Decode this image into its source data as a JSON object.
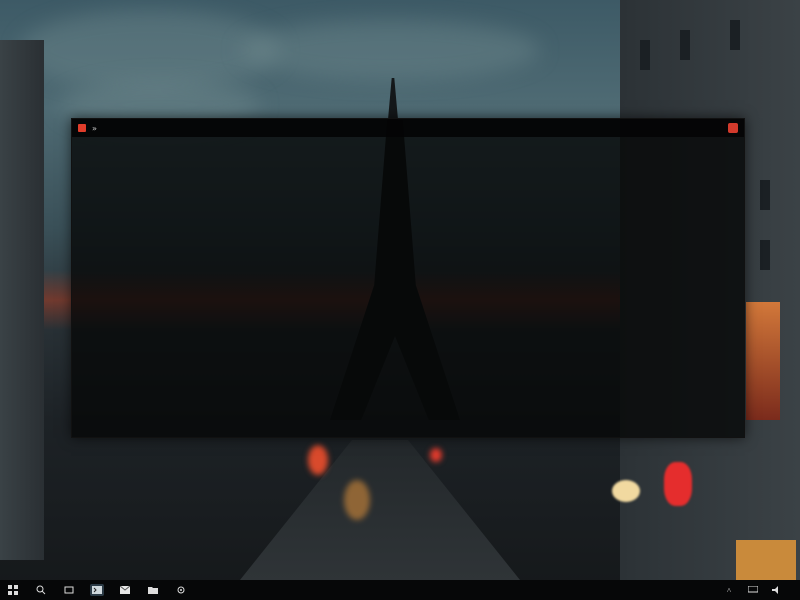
{
  "window": {
    "title": "",
    "menu": [
      "",
      "",
      "",
      "",
      "",
      "",
      "",
      ""
    ]
  },
  "terminal": {
    "left_pane_lines": [
      "",
      "",
      "",
      "",
      "",
      "",
      "",
      "",
      "",
      "",
      "",
      "",
      "",
      "",
      "",
      "",
      ""
    ],
    "right_pane_lines": [
      "",
      "",
      "",
      "",
      "",
      "",
      "",
      "",
      "",
      "",
      "",
      "",
      "",
      "",
      "",
      "",
      "",
      "",
      ""
    ]
  },
  "taskbar": {
    "items": [
      "start-icon",
      "search-icon",
      "task-view-icon",
      "terminal-icon",
      "mail-icon",
      "folder-icon",
      "settings-icon"
    ],
    "clock_time": "",
    "clock_date": ""
  },
  "colors": {
    "terminal_bg": "#060708",
    "close_button": "#d23a2c",
    "code_text": "#cfe7c9"
  }
}
